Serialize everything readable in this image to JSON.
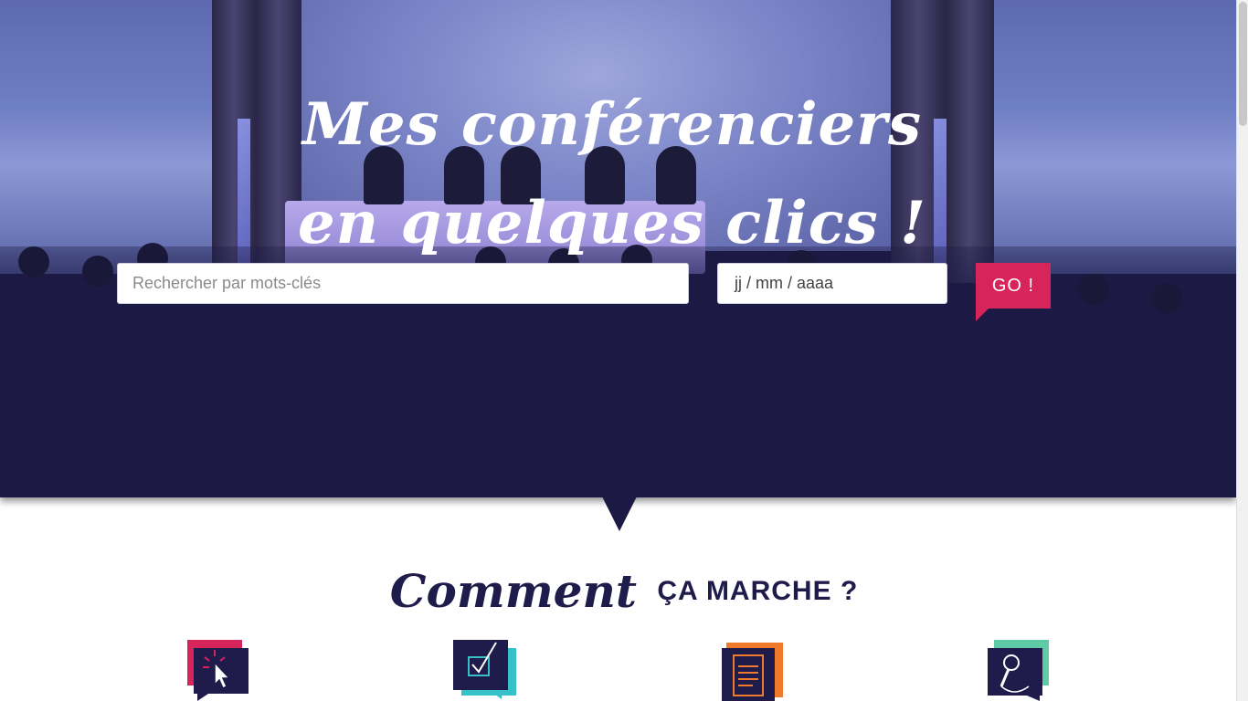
{
  "hero": {
    "headline_line1": "Mes conférenciers",
    "headline_line2": "en quelques clics !"
  },
  "search": {
    "keywords_placeholder": "Rechercher par mots-clés",
    "date_value": "jj / mm / aaaa",
    "go_label": "GO !"
  },
  "how": {
    "title_script": "Comment",
    "title_caps": "ÇA MARCHE ?",
    "steps": [
      {
        "icon": "cursor-click-icon",
        "accent": "#d7245a"
      },
      {
        "icon": "checkbox-icon",
        "accent": "#36c1c9"
      },
      {
        "icon": "document-icon",
        "accent": "#f07a2c"
      },
      {
        "icon": "microphone-icon",
        "accent": "#5fcaa6"
      }
    ]
  },
  "colors": {
    "brand_navy": "#1c1a44",
    "accent_pink": "#d7245a"
  }
}
